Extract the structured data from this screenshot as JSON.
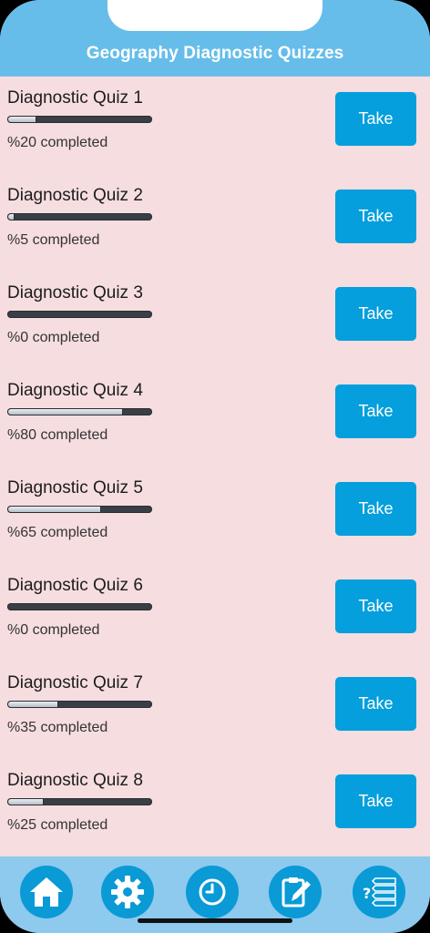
{
  "header": {
    "title": "Geography Diagnostic Quizzes"
  },
  "quizzes": [
    {
      "name": "Diagnostic Quiz 1",
      "progress": 20,
      "status": "%20 completed",
      "button": "Take"
    },
    {
      "name": "Diagnostic Quiz 2",
      "progress": 5,
      "status": "%5 completed",
      "button": "Take"
    },
    {
      "name": "Diagnostic Quiz 3",
      "progress": 0,
      "status": "%0 completed",
      "button": "Take"
    },
    {
      "name": "Diagnostic Quiz 4",
      "progress": 80,
      "status": "%80 completed",
      "button": "Take"
    },
    {
      "name": "Diagnostic Quiz 5",
      "progress": 65,
      "status": "%65 completed",
      "button": "Take"
    },
    {
      "name": "Diagnostic Quiz 6",
      "progress": 0,
      "status": "%0 completed",
      "button": "Take"
    },
    {
      "name": "Diagnostic Quiz 7",
      "progress": 35,
      "status": "%35 completed",
      "button": "Take"
    },
    {
      "name": "Diagnostic Quiz 8",
      "progress": 25,
      "status": "%25 completed",
      "button": "Take"
    }
  ],
  "tabbar": {
    "items": [
      {
        "icon": "home-icon"
      },
      {
        "icon": "gear-icon"
      },
      {
        "icon": "clock-icon"
      },
      {
        "icon": "notepad-pencil-icon"
      },
      {
        "icon": "quiz-list-icon"
      }
    ]
  },
  "colors": {
    "header": "#66bdea",
    "background": "#f6dde0",
    "button": "#049fdc",
    "tabbar": "#8ec9ee",
    "tab_circle": "#0a9ad6"
  }
}
